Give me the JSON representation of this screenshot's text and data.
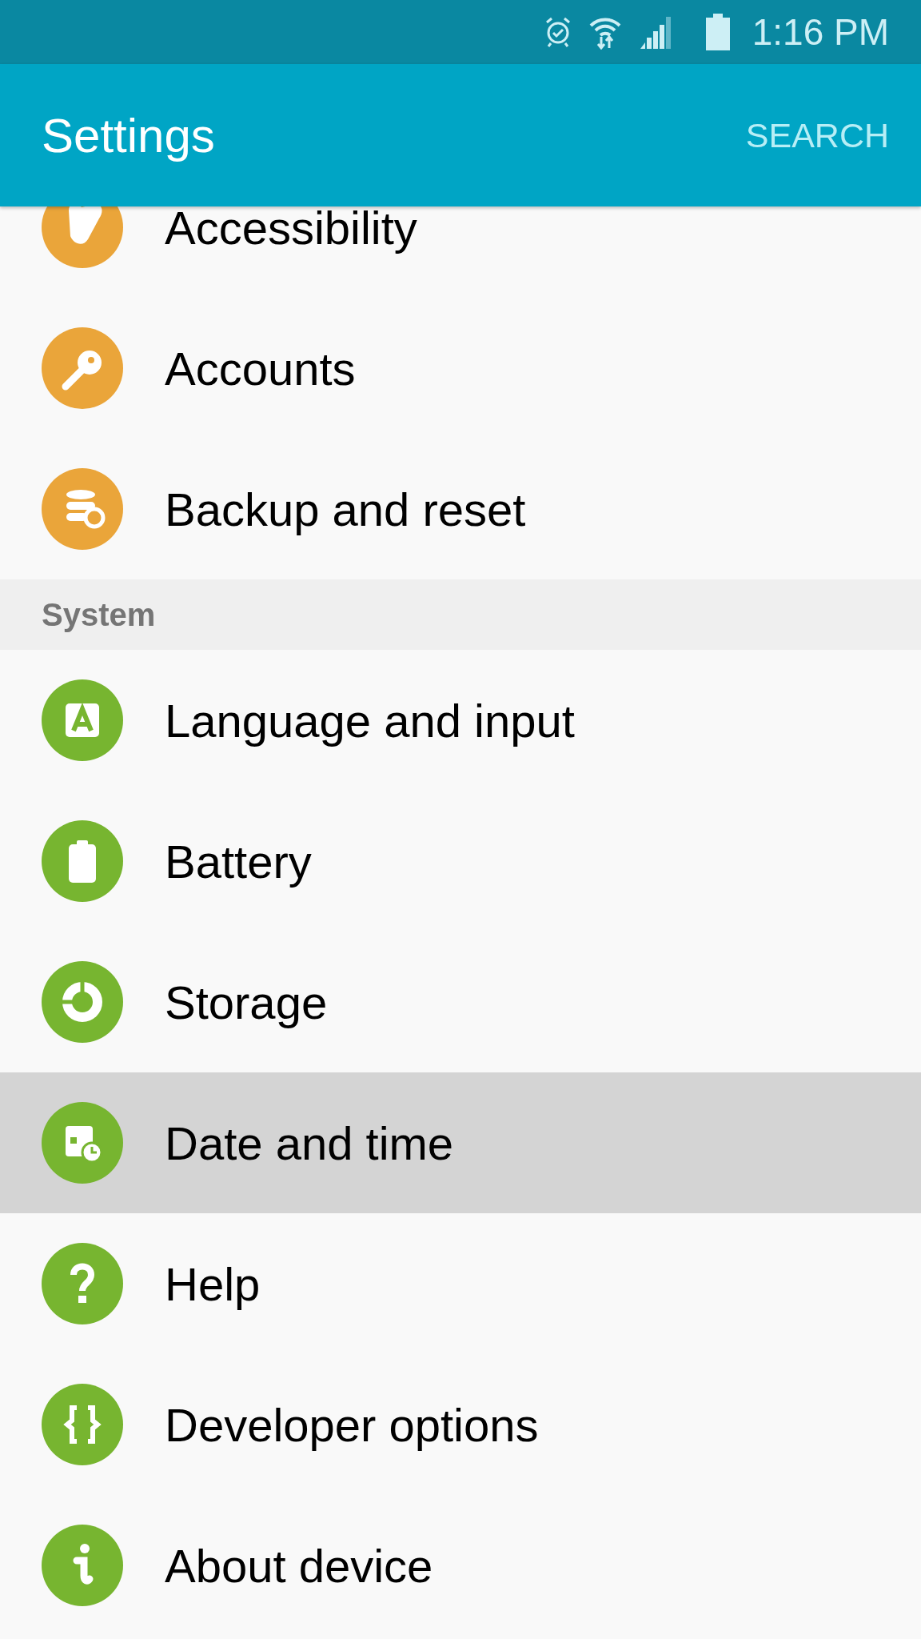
{
  "status_bar": {
    "time": "1:16 PM"
  },
  "app_bar": {
    "title": "Settings",
    "action": "SEARCH"
  },
  "sections": [
    {
      "items": [
        {
          "label": "Accessibility",
          "color": "#eaa53a",
          "selected": false
        },
        {
          "label": "Accounts",
          "color": "#eaa53a",
          "selected": false
        },
        {
          "label": "Backup and reset",
          "color": "#eaa53a",
          "selected": false
        }
      ]
    },
    {
      "header": "System",
      "items": [
        {
          "label": "Language and input",
          "color": "#77b530",
          "selected": false
        },
        {
          "label": "Battery",
          "color": "#77b530",
          "selected": false
        },
        {
          "label": "Storage",
          "color": "#77b530",
          "selected": false
        },
        {
          "label": "Date and time",
          "color": "#77b530",
          "selected": true
        },
        {
          "label": "Help",
          "color": "#77b530",
          "selected": false
        },
        {
          "label": "Developer options",
          "color": "#77b530",
          "selected": false
        },
        {
          "label": "About device",
          "color": "#77b530",
          "selected": false
        }
      ]
    }
  ]
}
